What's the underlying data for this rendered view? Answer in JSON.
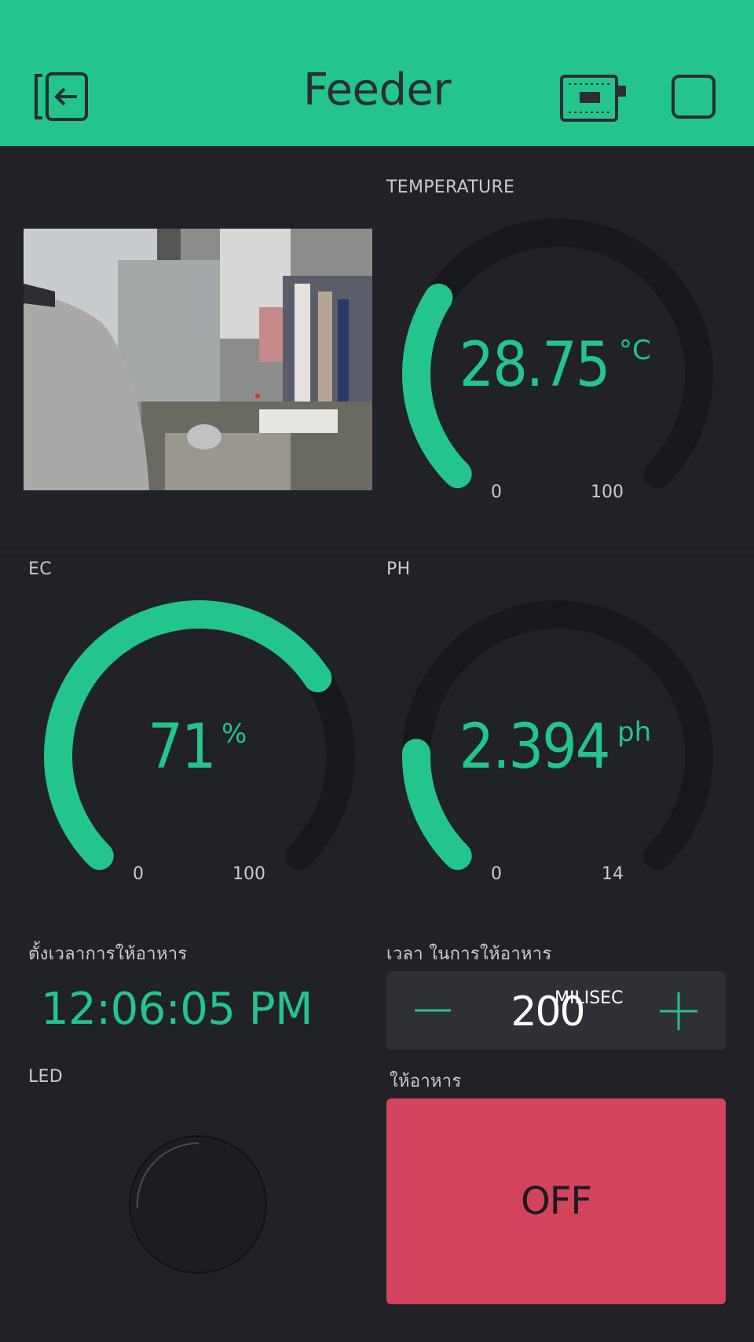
{
  "header": {
    "title": "Feeder",
    "back_icon": "exit-project-icon",
    "device_icon": "device-board-icon",
    "stop_icon": "stop-square-icon",
    "background_color": "#23c48e"
  },
  "camera": {
    "icon": "video-stream"
  },
  "temperature": {
    "label": "TEMPERATURE",
    "value": "28.75",
    "unit": "°C",
    "min": "0",
    "max": "100",
    "level": 0.2875
  },
  "ec": {
    "label": "EC",
    "value": "71",
    "unit": "%",
    "min": "0",
    "max": "100",
    "level": 0.71
  },
  "ph": {
    "label": "PH",
    "value": "2.394",
    "unit": "ph",
    "min": "0",
    "max": "14",
    "level": 0.171
  },
  "timer": {
    "label": "ตั้งเวลาการให้อาหาร",
    "value": "12:06:05 PM"
  },
  "duration": {
    "label": "เวลา ในการให้อาหาร",
    "value": "200",
    "unit": "MILISEC",
    "minus_icon": "minus-icon",
    "plus_icon": "plus-icon"
  },
  "led": {
    "label": "LED"
  },
  "feed": {
    "label": "ให้อาหาร",
    "button_label": "OFF",
    "button_color": "#d3435c"
  },
  "colors": {
    "accent": "#23c48e",
    "background": "#212227",
    "track": "#17181c"
  }
}
